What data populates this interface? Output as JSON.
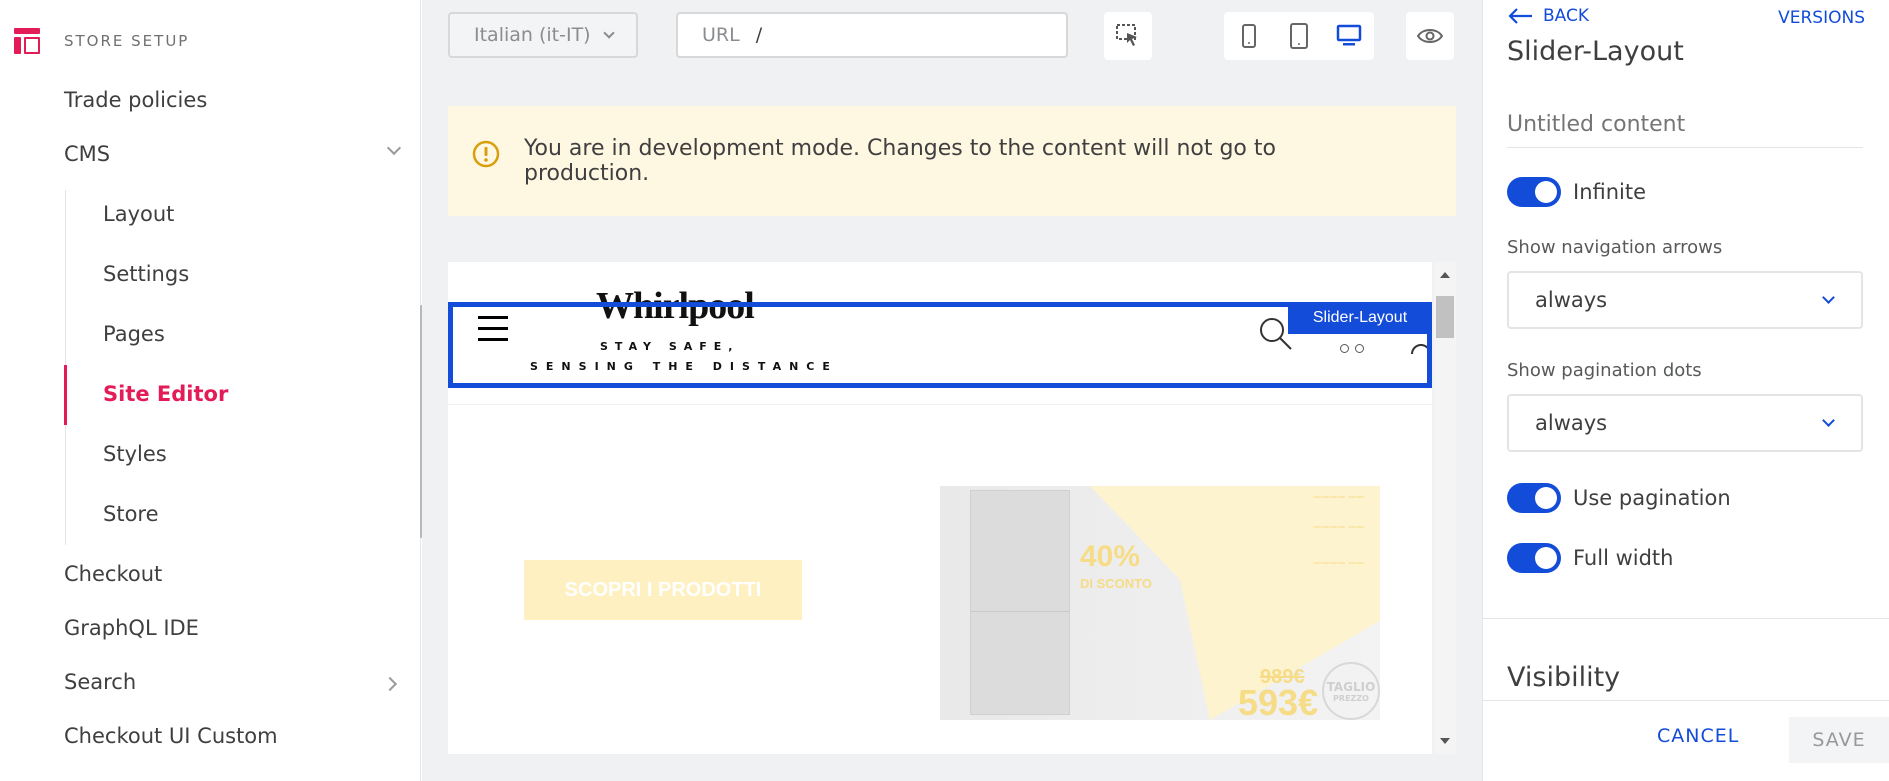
{
  "sidebar": {
    "header": "STORE SETUP",
    "items": {
      "trade_policies": "Trade policies",
      "cms": "CMS",
      "checkout": "Checkout",
      "graphql": "GraphQL IDE",
      "search": "Search",
      "checkout_ui": "Checkout UI Custom"
    },
    "cms_sub": {
      "layout": "Layout",
      "settings": "Settings",
      "pages": "Pages",
      "site_editor": "Site Editor",
      "styles": "Styles",
      "store": "Store"
    }
  },
  "toolbar": {
    "language": "Italian (it-IT)",
    "url_label": "URL",
    "url_value": "/"
  },
  "alert": {
    "message": "You are in development mode. Changes to the content will not go to production."
  },
  "preview": {
    "highlight_label": "Slider-Layout",
    "brand": "Whirlpool",
    "tagline_1": "STAY SAFE,",
    "tagline_2": "SENSING THE DISTANCE",
    "cta": "SCOPRI I PRODOTTI",
    "banner_percent": "40%",
    "banner_percent_sub": "DI SCONTO",
    "banner_old_price": "989€",
    "banner_new_price": "593€",
    "banner_badge_1": "TAGLIO",
    "banner_badge_2": "PREZZO"
  },
  "panel": {
    "back": "BACK",
    "versions": "VERSIONS",
    "title": "Slider-Layout",
    "name_placeholder": "Untitled content",
    "infinite": "Infinite",
    "nav_arrows_label": "Show navigation arrows",
    "nav_arrows_value": "always",
    "pagination_dots_label": "Show pagination dots",
    "pagination_dots_value": "always",
    "use_pagination": "Use pagination",
    "full_width": "Full width",
    "visibility": "Visibility",
    "cancel": "CANCEL",
    "save": "SAVE"
  },
  "colors": {
    "accent": "#134cd8",
    "brand_pink": "#e31c58",
    "alert_bg": "#fef7e1",
    "alert_icon": "#d99e0b"
  },
  "icons": [
    "store-setup-icon",
    "chevron-down-icon",
    "chevron-right-icon",
    "cursor-select-icon",
    "mobile-icon",
    "tablet-icon",
    "desktop-icon",
    "eye-icon",
    "warning-icon",
    "arrow-left-icon"
  ]
}
